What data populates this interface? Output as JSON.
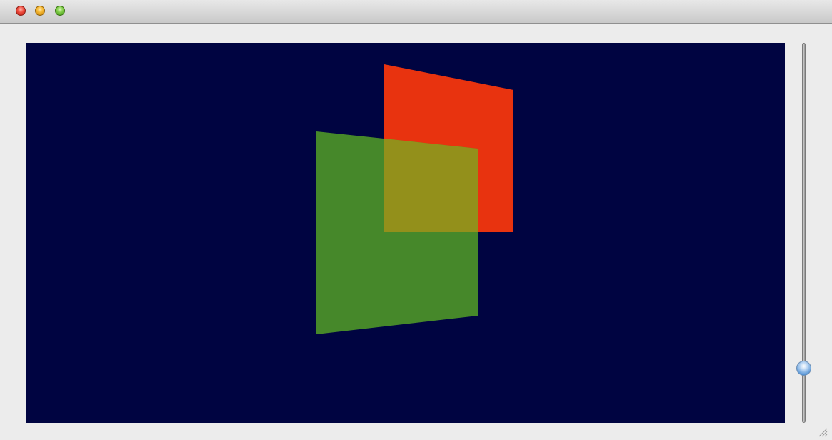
{
  "window": {
    "title": "",
    "controls": [
      {
        "name": "close",
        "icon": "close-circle-icon",
        "color": "#ee4a3c"
      },
      {
        "name": "minimize",
        "icon": "minimize-circle-icon",
        "color": "#f4b52e"
      },
      {
        "name": "zoom",
        "icon": "zoom-circle-icon",
        "color": "#7ecb45"
      }
    ]
  },
  "scene": {
    "background_color": "#000441",
    "planes": [
      {
        "name": "red-plane",
        "color": "#e8330f"
      },
      {
        "name": "green-plane",
        "color": "#46882a"
      },
      {
        "name": "overlap-region",
        "color": "#93901b"
      }
    ]
  },
  "slider": {
    "orientation": "vertical",
    "value": 0.13
  },
  "icons": {
    "resize_grip": "resize-grip-icon"
  }
}
